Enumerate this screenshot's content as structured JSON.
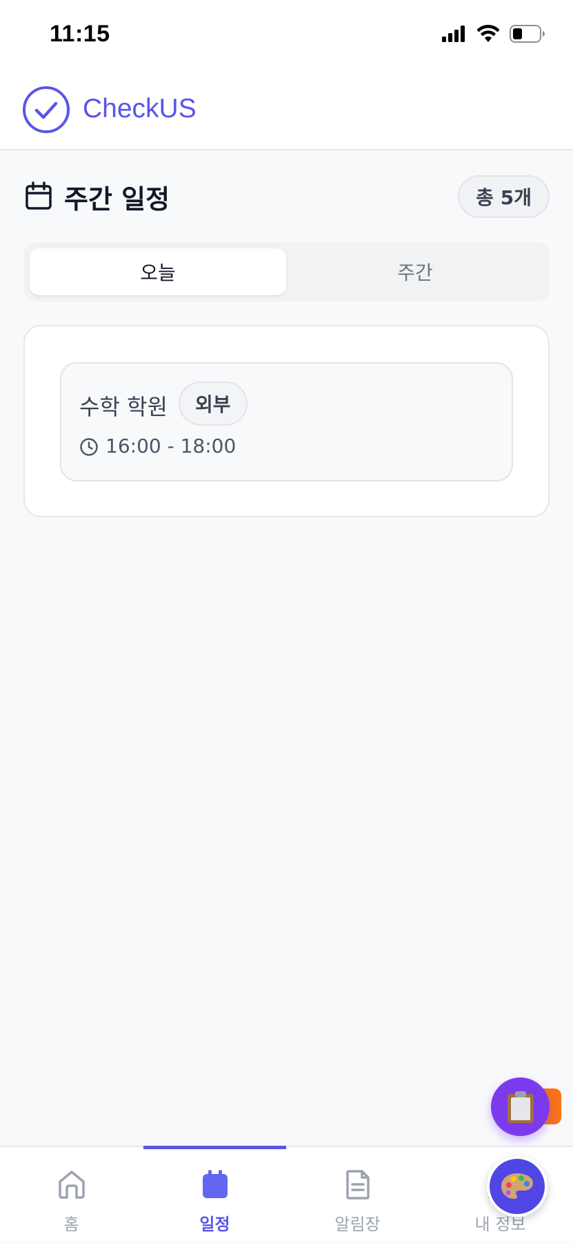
{
  "status_bar": {
    "time": "11:15"
  },
  "header": {
    "app_name": "CheckUS",
    "logo_icon": "check-circle-icon"
  },
  "section": {
    "title": "주간 일정",
    "icon": "calendar-icon",
    "count_badge": "총 5개"
  },
  "tabs": [
    {
      "label": "오늘",
      "active": true
    },
    {
      "label": "주간",
      "active": false
    }
  ],
  "schedule_items": [
    {
      "title": "수학 학원",
      "tag": "외부",
      "time": "16:00 - 18:00"
    }
  ],
  "bottom_nav": [
    {
      "label": "홈",
      "icon": "home-icon",
      "active": false
    },
    {
      "label": "일정",
      "icon": "calendar-icon",
      "active": true
    },
    {
      "label": "알림장",
      "icon": "document-icon",
      "active": false
    },
    {
      "label": "내 정보",
      "icon": "user-icon",
      "active": false
    }
  ],
  "floating_buttons": {
    "clipboard_icon": "clipboard-icon",
    "palette_icon": "palette-icon"
  },
  "colors": {
    "accent": "#5b55e6",
    "fab_purple": "#7c3aed",
    "fab_orange": "#f97316",
    "background": "#f8f9fb"
  }
}
